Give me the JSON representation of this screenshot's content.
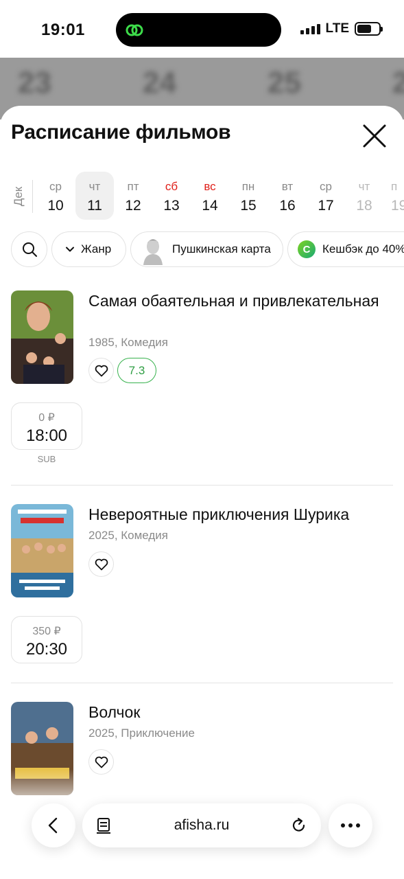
{
  "status_bar": {
    "time": "19:01",
    "network": "LTE"
  },
  "backdrop": {
    "dates": [
      "23",
      "24",
      "25",
      "2"
    ]
  },
  "sheet": {
    "title": "Расписание фильмов"
  },
  "calendar": {
    "month": "Дек",
    "days": [
      {
        "weekday": "ср",
        "day": "10",
        "state": "normal"
      },
      {
        "weekday": "чт",
        "day": "11",
        "state": "selected"
      },
      {
        "weekday": "пт",
        "day": "12",
        "state": "normal"
      },
      {
        "weekday": "сб",
        "day": "13",
        "state": "weekend"
      },
      {
        "weekday": "вс",
        "day": "14",
        "state": "weekend"
      },
      {
        "weekday": "пн",
        "day": "15",
        "state": "normal"
      },
      {
        "weekday": "вт",
        "day": "16",
        "state": "normal"
      },
      {
        "weekday": "ср",
        "day": "17",
        "state": "normal"
      },
      {
        "weekday": "чт",
        "day": "18",
        "state": "muted"
      },
      {
        "weekday": "п",
        "day": "19",
        "state": "muted"
      }
    ]
  },
  "filters": {
    "genre": "Жанр",
    "pushkin": "Пушкинская карта",
    "cashback": "Кешбэк до 40%",
    "cashback_badge": "C"
  },
  "movies": [
    {
      "title": "Самая обаятельная и привлекательная",
      "meta": "1985, Комедия",
      "rating": "7.3",
      "sessions": [
        {
          "price": "0 ₽",
          "time": "18:00",
          "format": "SUB"
        }
      ]
    },
    {
      "title": "Невероятные приключения Шурика",
      "meta": "2025, Комедия",
      "sessions": [
        {
          "price": "350 ₽",
          "time": "20:30"
        }
      ]
    },
    {
      "title": "Волчок",
      "meta": "2025, Приключение"
    }
  ],
  "browser": {
    "url": "afisha.ru"
  },
  "colors": {
    "accent_green": "#37b24d",
    "weekend_red": "#e0201a",
    "muted_gray": "#8a8a8a"
  }
}
